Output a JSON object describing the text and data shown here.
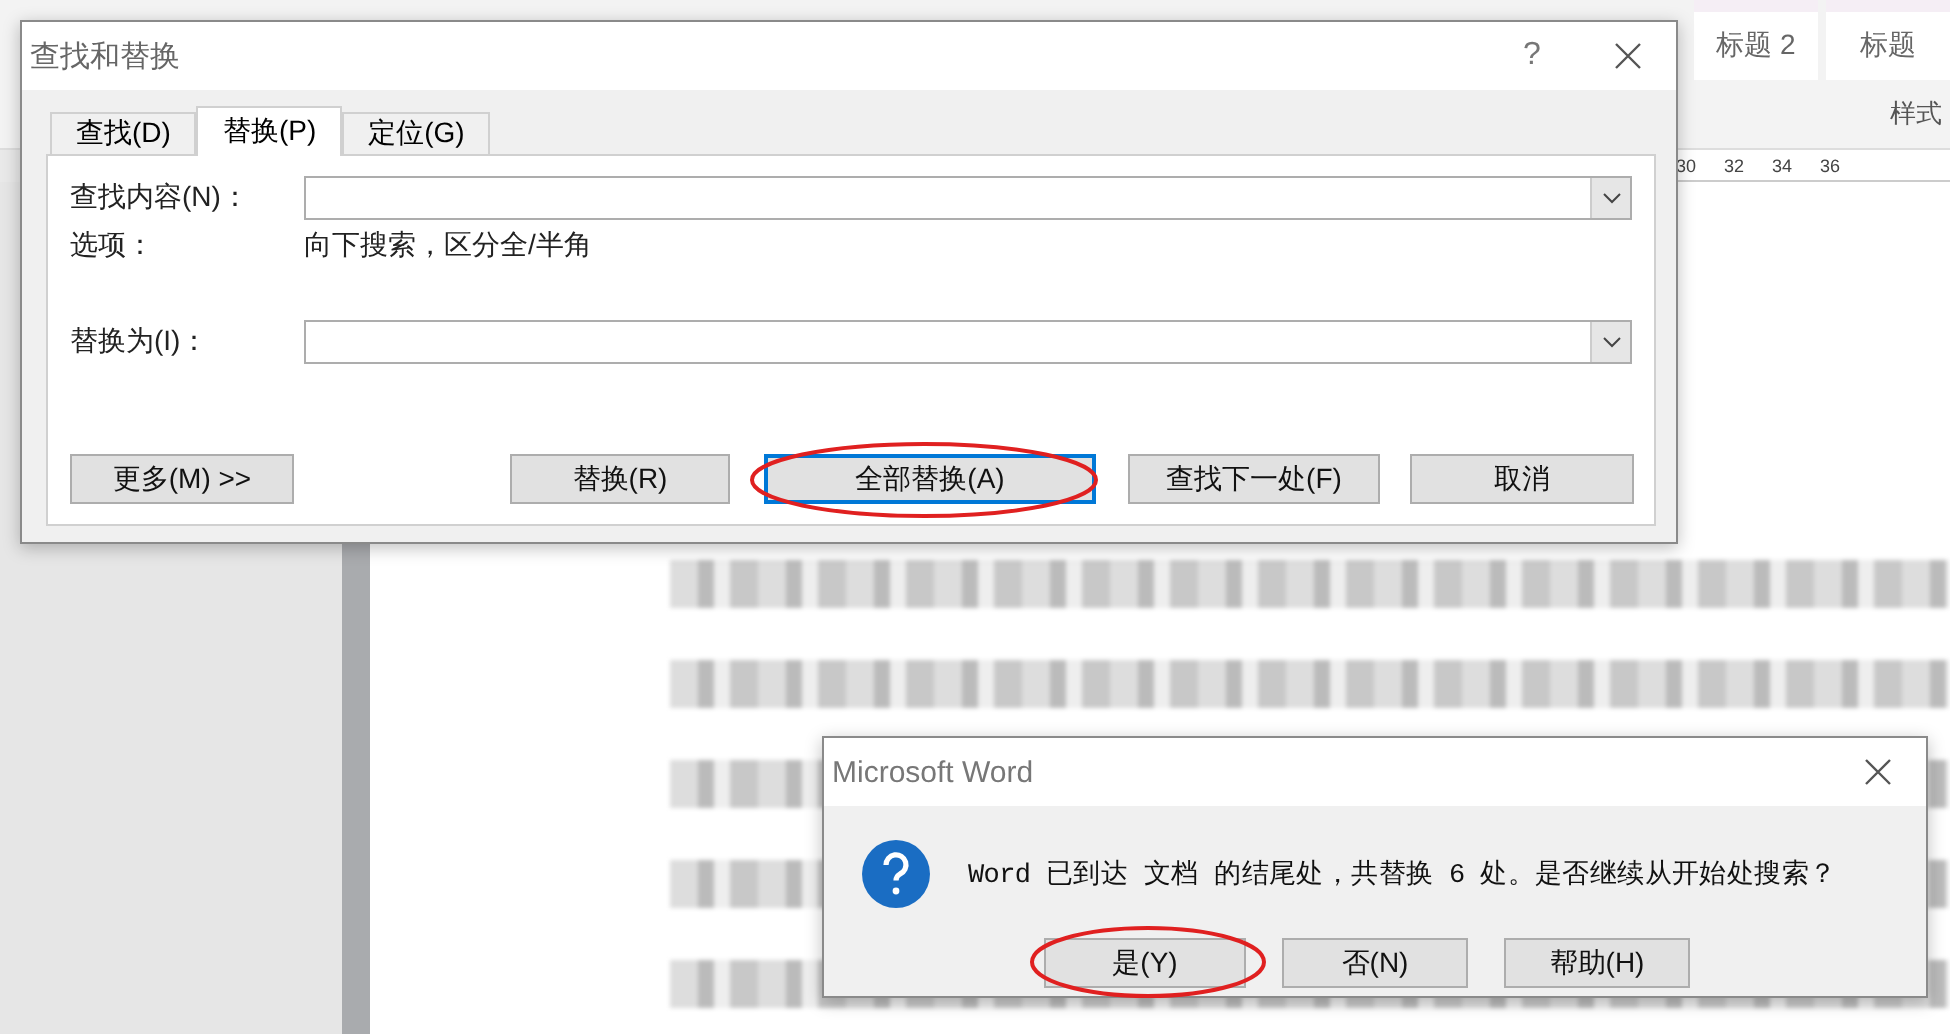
{
  "background_window": {
    "style_gallery": [
      "标题 2",
      "标题"
    ],
    "styles_group_label": "样式",
    "ruler_numbers": [
      "30",
      "32",
      "34",
      "36"
    ]
  },
  "find_replace_dialog": {
    "title": "查找和替换",
    "help_button": "?",
    "tabs": [
      {
        "label": "查找(D)",
        "selected": false
      },
      {
        "label": "替换(P)",
        "selected": true
      },
      {
        "label": "定位(G)",
        "selected": false
      }
    ],
    "find_label": "查找内容(N)：",
    "options_label": "选项：",
    "options_value": "向下搜索，区分全/半角",
    "replace_label": "替换为(I)：",
    "buttons": [
      {
        "label": "更多(M) >>",
        "focused": false,
        "circled": false
      },
      {
        "label": "替换(R)",
        "focused": false,
        "circled": false
      },
      {
        "label": "全部替换(A)",
        "focused": true,
        "circled": true
      },
      {
        "label": "查找下一处(F)",
        "focused": false,
        "circled": false
      },
      {
        "label": "取消",
        "focused": false,
        "circled": false
      }
    ]
  },
  "message_dialog": {
    "title": "Microsoft Word",
    "message": "Word 已到达 文档 的结尾处，共替换 6 处。是否继续从开始处搜索？",
    "buttons": [
      {
        "label": "是(Y)",
        "circled": true
      },
      {
        "label": "否(N)",
        "circled": false
      },
      {
        "label": "帮助(H)",
        "circled": false
      }
    ]
  }
}
